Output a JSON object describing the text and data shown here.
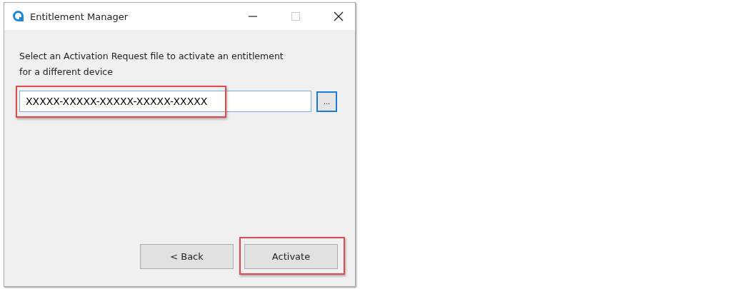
{
  "window": {
    "title": "Entitlement Manager"
  },
  "instructions": "Select an Activation Request file to activate an entitlement for a different device",
  "request_field": {
    "value": "XXXXX-XXXXX-XXXXX-XXXXX-XXXXX",
    "highlighted": true
  },
  "browse_button": {
    "label": "..."
  },
  "buttons": [
    {
      "label": "< Back"
    },
    {
      "label": "Activate",
      "highlighted": true
    }
  ]
}
